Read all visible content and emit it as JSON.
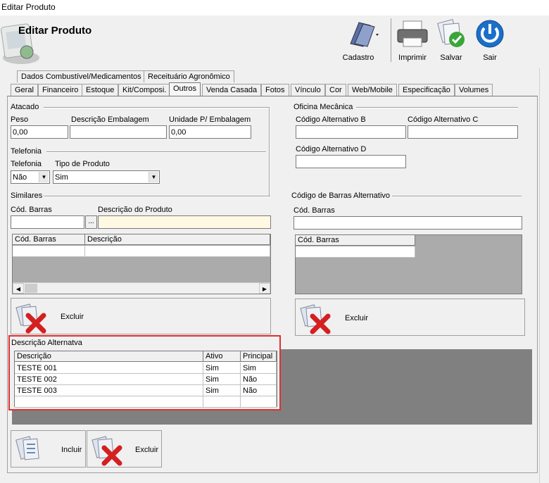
{
  "window": {
    "title": "Editar Produto"
  },
  "header": {
    "title": "Editar Produto"
  },
  "toolbar": {
    "cadastro": "Cadastro",
    "imprimir": "Imprimir",
    "salvar": "Salvar",
    "sair": "Sair"
  },
  "tabs_row1": [
    "Dados Combustível/Medicamentos",
    "Receituário Agronômico"
  ],
  "tabs_row2": [
    "Geral",
    "Financeiro",
    "Estoque",
    "Kit/Composi.",
    "Outros",
    "Venda Casada",
    "Fotos",
    "Vínculo",
    "Cor",
    "Web/Mobile",
    "Especificação",
    "Volumes"
  ],
  "atacado": {
    "group": "Atacado",
    "peso_label": "Peso",
    "peso_value": "0,00",
    "desc_label": "Descrição Embalagem",
    "desc_value": "",
    "unidade_label": "Unidade P/ Embalagem",
    "unidade_value": "0,00"
  },
  "telefonia": {
    "group": "Telefonia",
    "tel_label": "Telefonia",
    "tel_value": "Não",
    "tipo_label": "Tipo de Produto",
    "tipo_value": "Sim"
  },
  "oficina": {
    "group": "Oficina Mecânica",
    "cod_b": "Código Alternativo B",
    "cod_c": "Código Alternativo C",
    "cod_d": "Código Alternativo D"
  },
  "similares": {
    "group": "Similares",
    "cod_label": "Cód. Barras",
    "ellipsis": "...",
    "desc_label": "Descrição do Produto",
    "col1": "Cód. Barras",
    "col2": "Descrição",
    "excluir": "Excluir"
  },
  "barras_alt": {
    "group": "Código de Barras Alternativo",
    "cod_label": "Cód. Barras",
    "col1": "Cód. Barras",
    "excluir": "Excluir"
  },
  "desc_alt": {
    "group": "Descrição Alternatva",
    "columns": [
      "Descrição",
      "Ativo",
      "Principal"
    ],
    "rows": [
      [
        "TESTE 001",
        "Sim",
        "Sim"
      ],
      [
        "TESTE 002",
        "Sim",
        "Não"
      ],
      [
        "TESTE 003",
        "Sim",
        "Não"
      ]
    ]
  },
  "bottom": {
    "incluir": "Incluir",
    "excluir": "Excluir"
  },
  "colors": {
    "accent_red": "#e03030",
    "sair_blue": "#1a6fc9",
    "salvar_green": "#3aa63a"
  }
}
